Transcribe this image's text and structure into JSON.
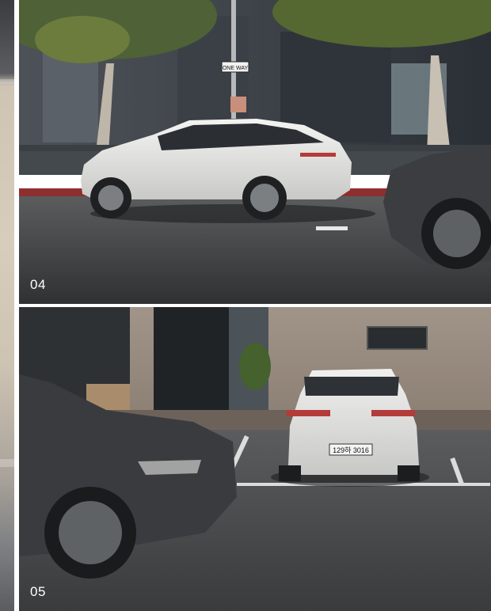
{
  "panels": [
    {
      "id": "04",
      "label": "04"
    },
    {
      "id": "05",
      "label": "05",
      "plate": "129하 3016"
    }
  ],
  "street_sign": "ONE WAY"
}
